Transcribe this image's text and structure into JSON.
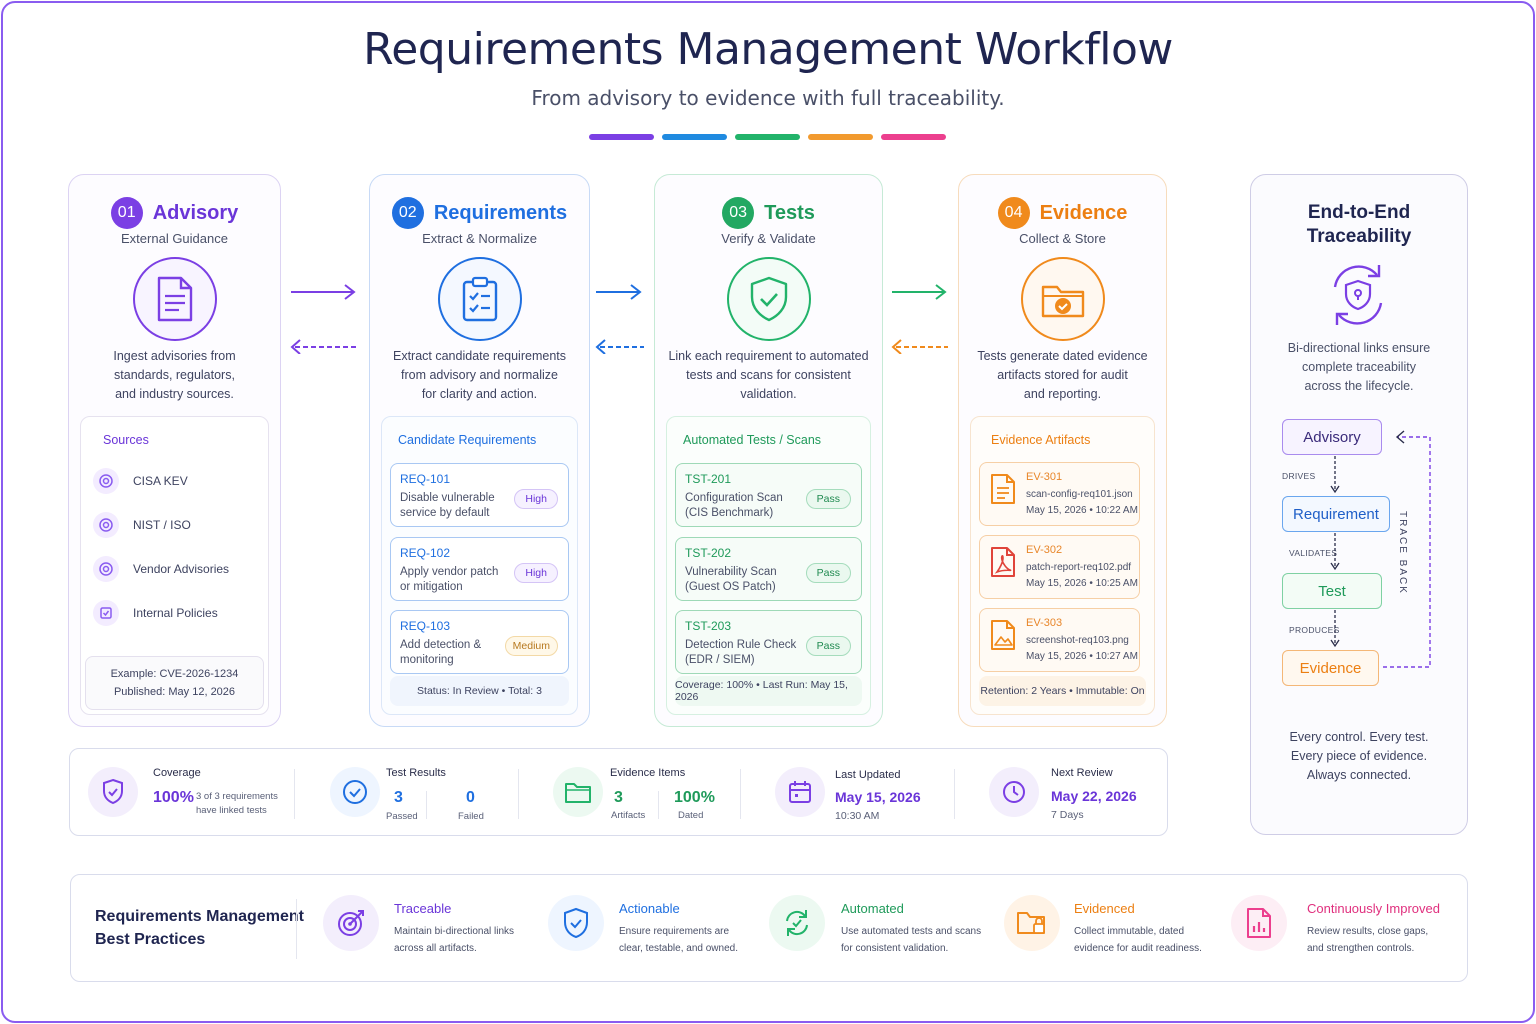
{
  "header": {
    "title": "Requirements Management Workflow",
    "subtitle": "From advisory to evidence with full traceability."
  },
  "colors": {
    "purple": "#7b3fe4",
    "blue": "#1f6fe0",
    "green": "#22b36a",
    "orange": "#f08a1c",
    "pink": "#ec3f8e"
  },
  "stages": [
    {
      "num": "01",
      "title": "Advisory",
      "subtitle": "External Guidance",
      "icon": "document-icon",
      "description": [
        "Ingest advisories from",
        "standards, regulators,",
        "and industry sources."
      ],
      "panel_title": "Sources",
      "sources": [
        "CISA KEV",
        "NIST / ISO",
        "Vendor Advisories",
        "Internal Policies"
      ],
      "example": [
        "Example: CVE-2026-1234",
        "Published: May 12, 2026"
      ]
    },
    {
      "num": "02",
      "title": "Requirements",
      "subtitle": "Extract & Normalize",
      "icon": "clipboard-check-icon",
      "description": [
        "Extract candidate requirements",
        "from advisory and normalize",
        "for clarity and action."
      ],
      "panel_title": "Candidate Requirements",
      "items": [
        {
          "code": "REQ-101",
          "desc": [
            "Disable vulnerable",
            "service by default"
          ],
          "badge": "High"
        },
        {
          "code": "REQ-102",
          "desc": [
            "Apply vendor patch",
            "or mitigation"
          ],
          "badge": "High"
        },
        {
          "code": "REQ-103",
          "desc": [
            "Add detection &",
            "monitoring"
          ],
          "badge": "Medium"
        }
      ],
      "footer": "Status: In Review   •   Total: 3"
    },
    {
      "num": "03",
      "title": "Tests",
      "subtitle": "Verify & Validate",
      "icon": "shield-check-icon",
      "description": [
        "Link each requirement to automated",
        "tests and scans for consistent",
        "validation."
      ],
      "panel_title": "Automated Tests / Scans",
      "items": [
        {
          "code": "TST-201",
          "desc": [
            "Configuration Scan",
            "(CIS Benchmark)"
          ],
          "badge": "Pass"
        },
        {
          "code": "TST-202",
          "desc": [
            "Vulnerability Scan",
            "(Guest OS Patch)"
          ],
          "badge": "Pass"
        },
        {
          "code": "TST-203",
          "desc": [
            "Detection Rule Check",
            "(EDR / SIEM)"
          ],
          "badge": "Pass"
        }
      ],
      "footer": "Coverage: 100%   •   Last Run: May 15, 2026"
    },
    {
      "num": "04",
      "title": "Evidence",
      "subtitle": "Collect & Store",
      "icon": "folder-check-icon",
      "description": [
        "Tests generate dated evidence",
        "artifacts stored for audit",
        "and reporting."
      ],
      "panel_title": "Evidence Artifacts",
      "items": [
        {
          "code": "EV-301",
          "file": "scan-config-req101.json",
          "date": "May 15, 2026 • 10:22 AM",
          "icon": "json-file-icon"
        },
        {
          "code": "EV-302",
          "file": "patch-report-req102.pdf",
          "date": "May 15, 2026 • 10:25 AM",
          "icon": "pdf-file-icon"
        },
        {
          "code": "EV-303",
          "file": "screenshot-req103.png",
          "date": "May 15, 2026 • 10:27 AM",
          "icon": "image-file-icon"
        }
      ],
      "footer": "Retention: 2 Years   •   Immutable: On"
    }
  ],
  "traceability": {
    "title": [
      "End-to-End",
      "Traceability"
    ],
    "description": [
      "Bi-directional links ensure",
      "complete traceability",
      "across the lifecycle."
    ],
    "nodes": [
      "Advisory",
      "Requirement",
      "Test",
      "Evidence"
    ],
    "edge_labels": [
      "DRIVES",
      "VALIDATES",
      "PRODUCES"
    ],
    "back_label": "TRACE BACK",
    "footer": [
      "Every control. Every test.",
      "Every piece of evidence.",
      "Always connected."
    ]
  },
  "metrics": {
    "coverage": {
      "label": "Coverage",
      "value": "100%",
      "note": [
        "3 of 3 requirements",
        "have linked tests"
      ]
    },
    "test_results": {
      "label": "Test Results",
      "passed": "3",
      "passed_label": "Passed",
      "failed": "0",
      "failed_label": "Failed"
    },
    "evidence_items": {
      "label": "Evidence Items",
      "artifacts": "3",
      "artifacts_label": "Artifacts",
      "dated": "100%",
      "dated_label": "Dated"
    },
    "last_updated": {
      "label": "Last Updated",
      "date": "May 15, 2026",
      "time": "10:30 AM"
    },
    "next_review": {
      "label": "Next Review",
      "date": "May 22, 2026",
      "days": "7 Days"
    }
  },
  "best_practices": {
    "title": [
      "Requirements Management",
      "Best Practices"
    ],
    "items": [
      {
        "title": "Traceable",
        "desc": [
          "Maintain bi-directional links",
          "across all artifacts."
        ],
        "icon": "target-icon"
      },
      {
        "title": "Actionable",
        "desc": [
          "Ensure requirements are",
          "clear, testable, and owned."
        ],
        "icon": "shield-check-icon"
      },
      {
        "title": "Automated",
        "desc": [
          "Use automated tests and scans",
          "for consistent validation."
        ],
        "icon": "refresh-check-icon"
      },
      {
        "title": "Evidenced",
        "desc": [
          "Collect immutable, dated",
          "evidence for audit readiness."
        ],
        "icon": "folder-lock-icon"
      },
      {
        "title": "Continuously Improved",
        "desc": [
          "Review results, close gaps,",
          "and strengthen controls."
        ],
        "icon": "report-chart-icon"
      }
    ]
  }
}
